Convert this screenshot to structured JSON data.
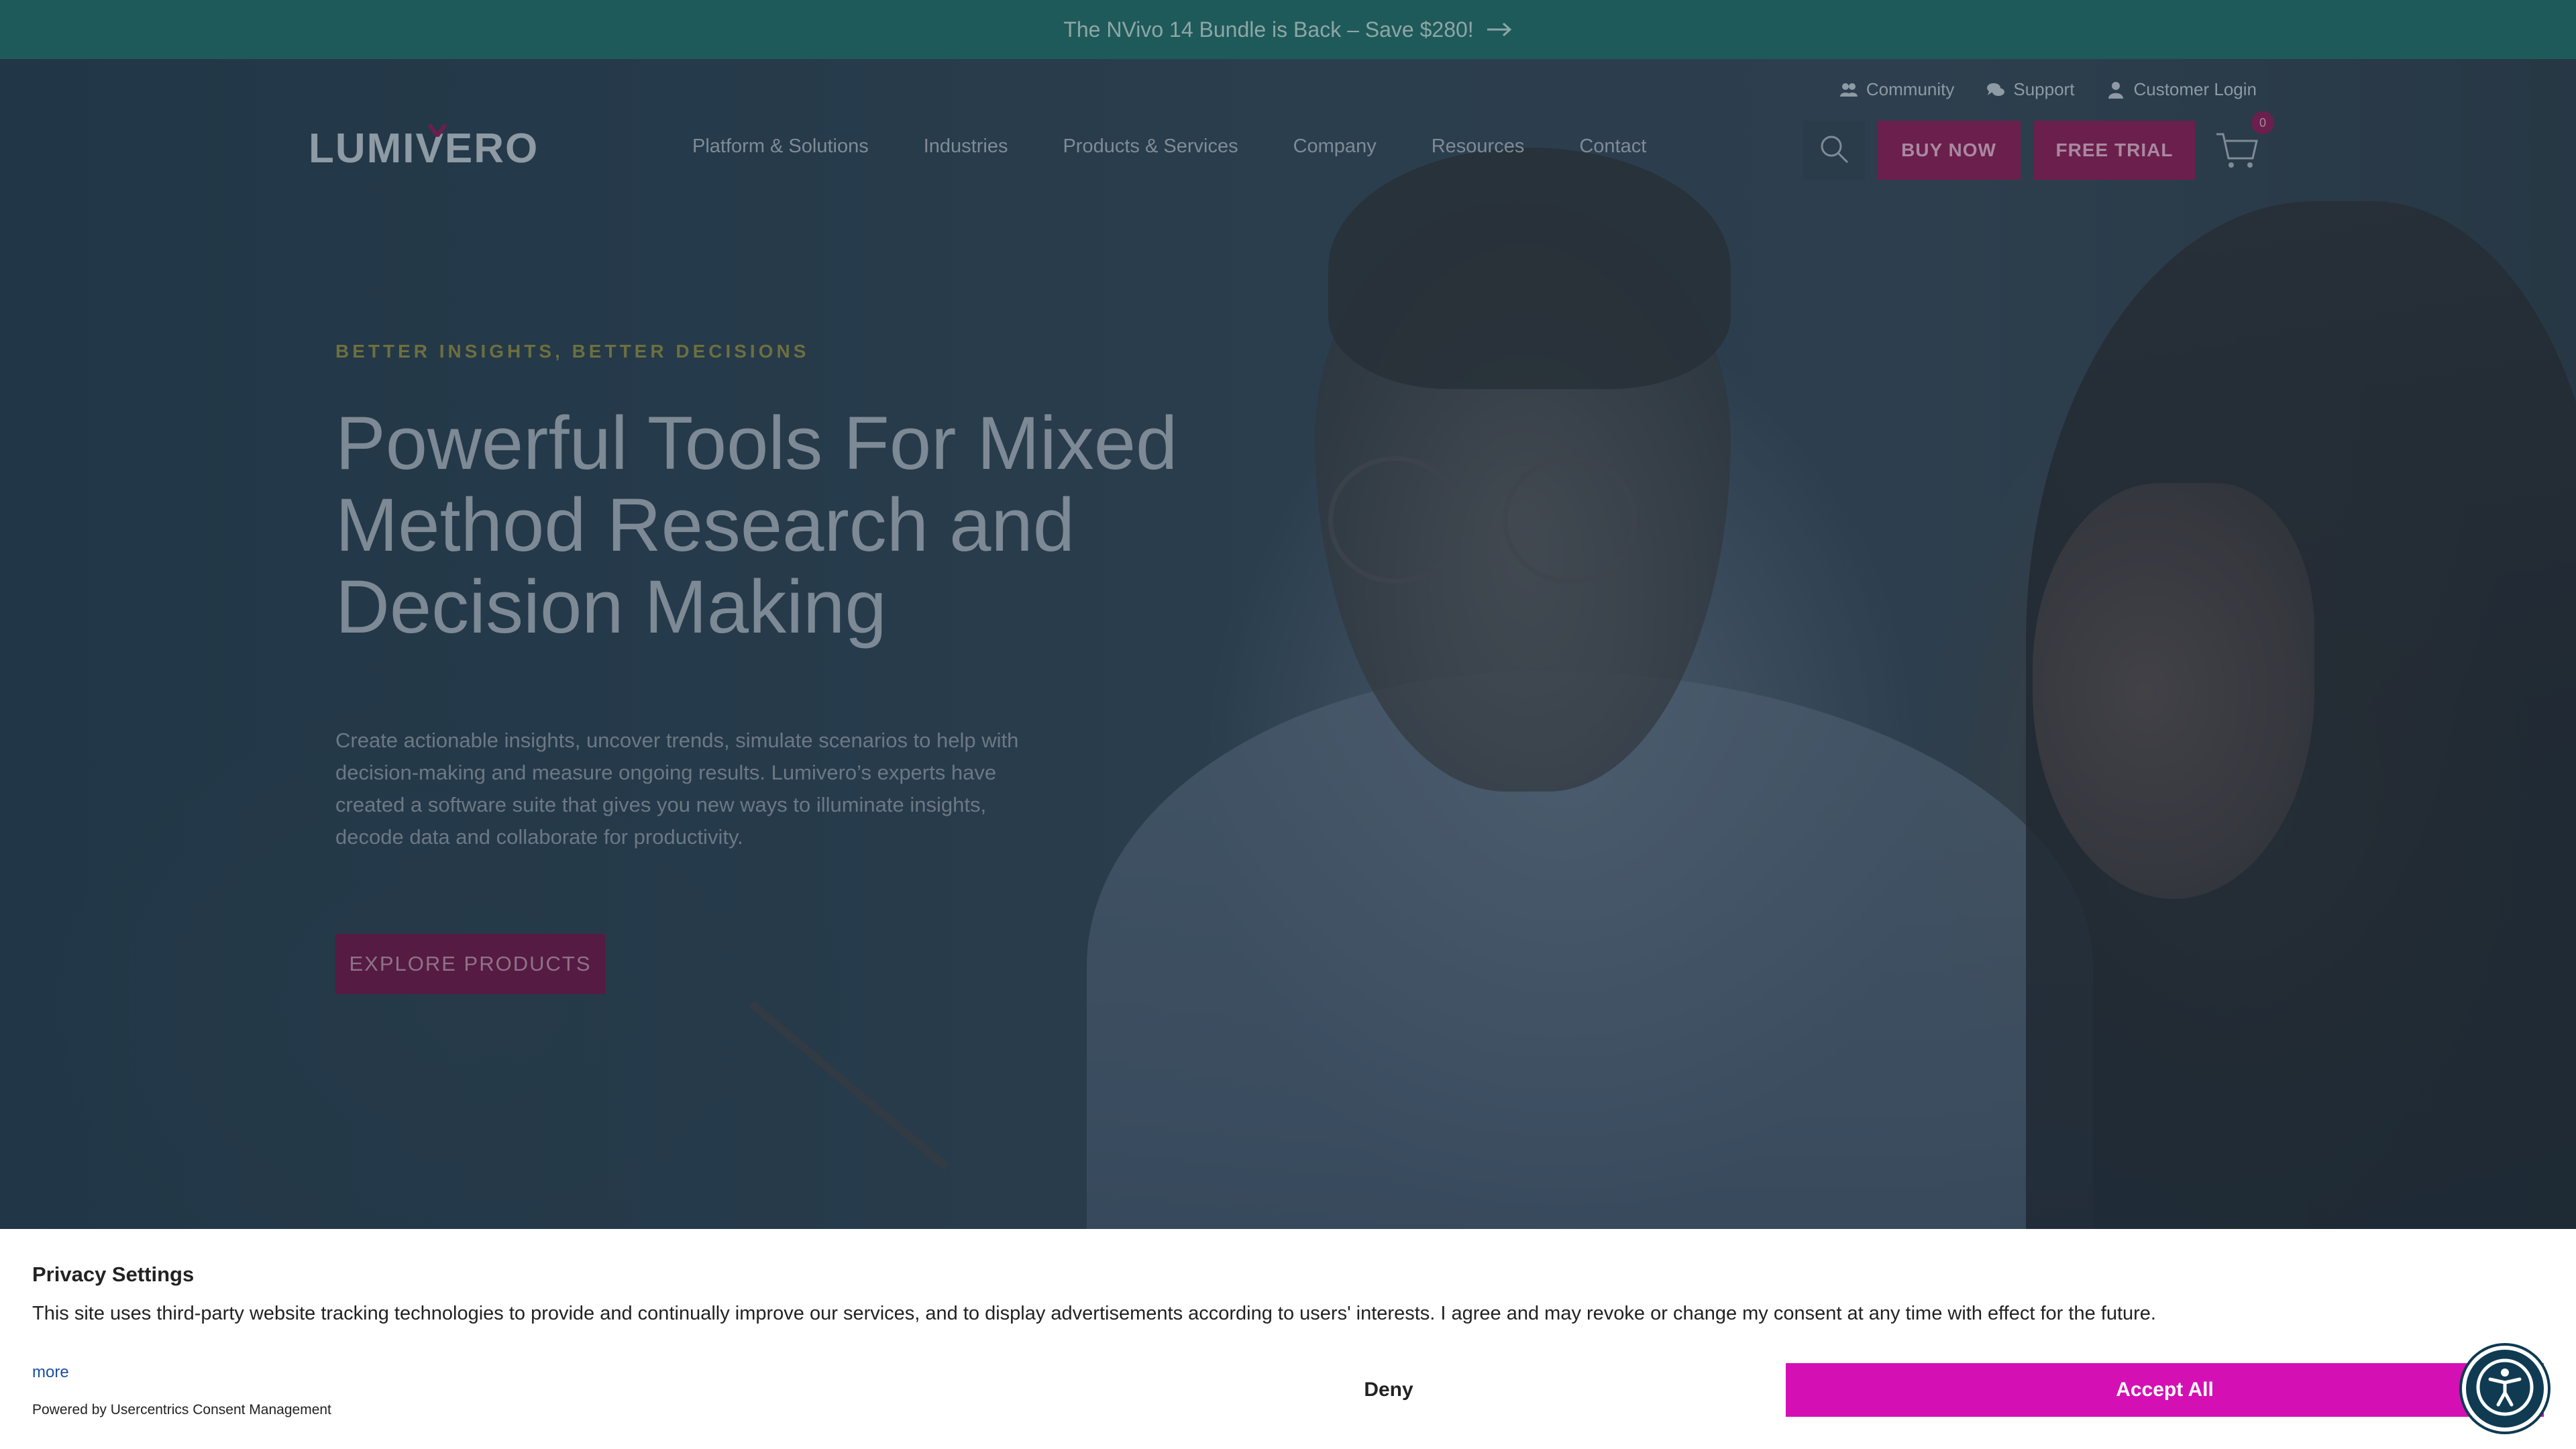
{
  "announcement": {
    "text": "The NVivo 14 Bundle is Back – Save $280!",
    "arrow_icon": "arrow-right-icon"
  },
  "utility_links": [
    {
      "label": "Community",
      "icon": "community-icon"
    },
    {
      "label": "Support",
      "icon": "chat-bubbles-icon"
    },
    {
      "label": "Customer Login",
      "icon": "user-icon"
    }
  ],
  "brand": {
    "logo_text": "LUMIVERO"
  },
  "nav": {
    "items": [
      "Platform & Solutions",
      "Industries",
      "Products & Services",
      "Company",
      "Resources",
      "Contact"
    ]
  },
  "header_actions": {
    "buy_label": "BUY NOW",
    "trial_label": "FREE TRIAL",
    "cart_count": "0"
  },
  "hero": {
    "eyebrow": "BETTER INSIGHTS, BETTER DECISIONS",
    "headline": "Powerful Tools For Mixed Method Research and Decision Making",
    "body": "Create actionable insights, uncover trends, simulate scenarios to help with decision-making and measure ongoing results. Lumivero’s experts have created a software suite that gives you new ways to illuminate insights, decode data and collaborate for productivity.",
    "cta_label": "EXPLORE PRODUCTS"
  },
  "consent": {
    "title": "Privacy Settings",
    "text": "This site uses third-party website tracking technologies to provide and continually improve our services, and to display advertisements according to users' interests. I agree and may revoke or change my consent at any time with effect for the future.",
    "more_label": "more",
    "powered_by": "Powered by Usercentrics Consent Management",
    "deny_label": "Deny",
    "accept_label": "Accept All"
  },
  "colors": {
    "announcement_bg": "#1f5a5a",
    "brand_magenta": "#d410b4",
    "accept_button": "#d410b4"
  }
}
